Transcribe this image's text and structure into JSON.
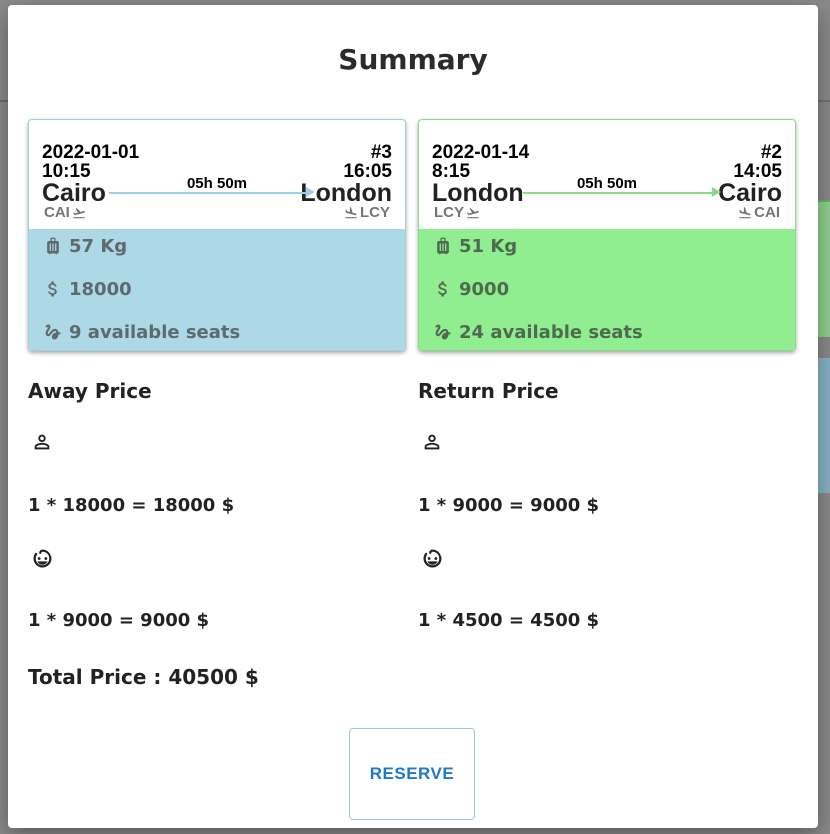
{
  "modal": {
    "title": "Summary"
  },
  "away_flight": {
    "date": "2022-01-01",
    "departure_time": "10:15",
    "flight_number": "#3",
    "arrival_time": "16:05",
    "from_city": "Cairo",
    "to_city": "London",
    "duration": "05h 50m",
    "from_code": "CAI",
    "to_code": "LCY",
    "baggage": "57 Kg",
    "price": "18000",
    "seats": "9 available seats",
    "color": "#add8e6"
  },
  "return_flight": {
    "date": "2022-01-14",
    "departure_time": "8:15",
    "flight_number": "#2",
    "arrival_time": "14:05",
    "from_city": "London",
    "to_city": "Cairo",
    "duration": "05h 50m",
    "from_code": "LCY",
    "to_code": "CAI",
    "baggage": "51 Kg",
    "price": "9000",
    "seats": "24 available seats",
    "color": "#90ee90"
  },
  "away_price": {
    "title": "Away Price",
    "adult_line": "1 * 18000 = 18000 $",
    "child_line": "1 * 9000 = 9000 $"
  },
  "return_price": {
    "title": "Return Price",
    "adult_line": "1 * 9000 = 9000 $",
    "child_line": "1 * 4500 = 4500 $"
  },
  "total": "Total Price : 40500 $",
  "reserve_label": "RESERVE",
  "icons": {
    "baggage": "luggage-icon",
    "price": "dollar-icon",
    "seats": "seat-icon",
    "departure": "flight-takeoff-icon",
    "arrival": "flight-land-icon",
    "adult": "person-icon",
    "child": "child-icon"
  }
}
